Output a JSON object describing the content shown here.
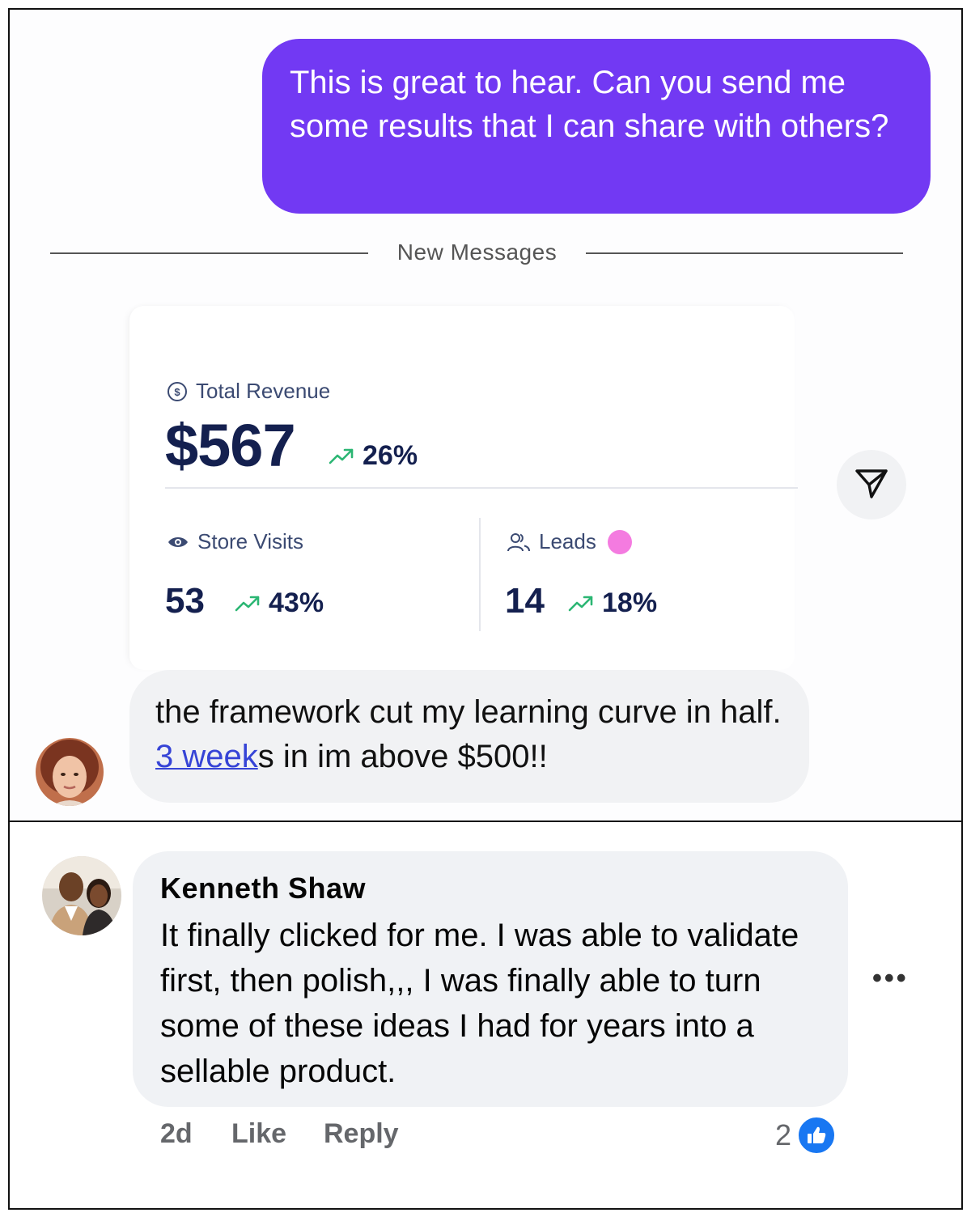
{
  "chat": {
    "outgoing_message": "This is great to hear. Can you send me some results that I can share with others?",
    "divider_label": "New Messages",
    "stats": {
      "revenue_label": "Total Revenue",
      "revenue_value": "$567",
      "revenue_change": "26%",
      "visits_label": "Store Visits",
      "visits_value": "53",
      "visits_change": "43%",
      "leads_label": "Leads",
      "leads_value": "14",
      "leads_change": "18%",
      "trend_color": "#2bb673",
      "leads_dot_color": "#f47be0",
      "accent_color": "#7239f3"
    },
    "incoming_message": {
      "before_link": "the framework cut my learning curve in half. ",
      "link_text": "3 week",
      "after_link": "s in im above $500!!"
    }
  },
  "comment": {
    "author": "Kenneth Shaw",
    "text": "It finally clicked for me. I was able to validate first, then polish,,, I was finally able to turn some of these ideas I had for years into a sellable product.",
    "time": "2d",
    "like_label": "Like",
    "reply_label": "Reply",
    "reaction_count": "2",
    "more_label": "•••",
    "reaction_color": "#1877f2"
  },
  "icons": {
    "revenue": "dollar-circle-icon",
    "visits": "eye-icon",
    "leads": "users-icon",
    "trend": "trending-up-icon",
    "send": "send-icon",
    "reaction": "thumbs-up-icon"
  }
}
